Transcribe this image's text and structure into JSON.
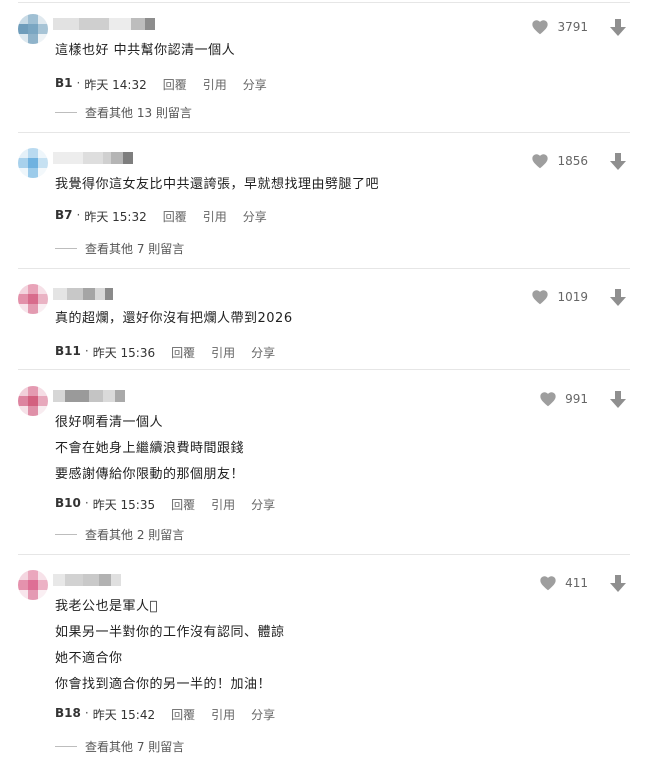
{
  "comments": [
    {
      "lines": [
        "這樣也好 中共幫你認清一個人"
      ],
      "floor": "B1",
      "time": "昨天 14:32",
      "likes": "3791",
      "more_replies": "查看其他 13 則留言",
      "avatar_color": "#7aa6c2"
    },
    {
      "lines": [
        "我覺得你這女友比中共還誇張，早就想找理由劈腿了吧"
      ],
      "floor": "B7",
      "time": "昨天 15:32",
      "likes": "1856",
      "more_replies": "查看其他 7 則留言",
      "avatar_color": "#8cc3e6"
    },
    {
      "lines": [
        "真的超爛，還好你沒有把爛人帶到2026"
      ],
      "floor": "B11",
      "time": "昨天 15:36",
      "likes": "1019",
      "more_replies": "",
      "avatar_color": "#d86c8c"
    },
    {
      "lines": [
        "很好啊看清一個人",
        "不會在她身上繼續浪費時間跟錢",
        "要感謝傳給你限動的那個朋友！"
      ],
      "floor": "B10",
      "time": "昨天 15:35",
      "likes": "991",
      "more_replies": "查看其他 2 則留言",
      "avatar_color": "#d3607f"
    },
    {
      "lines": [
        "我老公也是軍人􏿽",
        "如果另一半對你的工作沒有認同、體諒",
        "她不適合你",
        "你會找到適合你的另一半的！加油！"
      ],
      "floor": "B18",
      "time": "昨天 15:42",
      "likes": "411",
      "more_replies": "查看其他 7 則留言",
      "avatar_color": "#de6f95"
    }
  ],
  "actions": {
    "reply": "回覆",
    "quote": "引用",
    "share": "分享"
  },
  "icons": {
    "like": "heart-icon",
    "dislike": "down-arrow-icon"
  },
  "colors": {
    "icon_gray": "#9e9e9e",
    "divider": "#e6e6e6"
  }
}
